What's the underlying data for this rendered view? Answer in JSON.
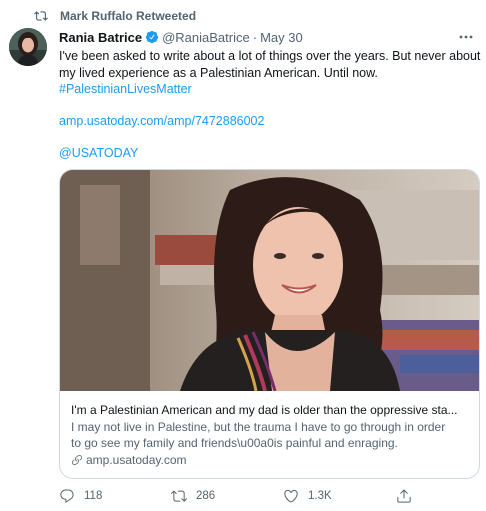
{
  "retweet_banner": {
    "text": "Mark Ruffalo Retweeted",
    "icon": "retweet-icon"
  },
  "author": {
    "name": "Rania Batrice",
    "handle": "@RaniaBatrice",
    "separator": "·",
    "date": "May 30",
    "verified": true
  },
  "tweet": {
    "lines": [
      "I've been asked to write about a lot of things over the years. But never about",
      "my lived experience as a Palestinian American. Until now."
    ],
    "hashtag": "#PalestinianLivesMatter",
    "url": "amp.usatoday.com/amp/7472886002",
    "mention": "@USATODAY"
  },
  "card": {
    "title": "I'm a Palestinian American and my dad is older than the oppressive sta...",
    "description_lines": [
      "I may not live in Palestine, but the trauma I have to go through in order",
      "to go see my family and friends\\u00a0is painful and enraging."
    ],
    "domain": "amp.usatoday.com"
  },
  "actions": {
    "reply_count": "118",
    "retweet_count": "286",
    "like_count": "1.3K"
  },
  "colors": {
    "link": "#1d9bf0",
    "secondary_text": "#536471",
    "primary_text": "#0f1419",
    "border": "#cfd9de"
  }
}
